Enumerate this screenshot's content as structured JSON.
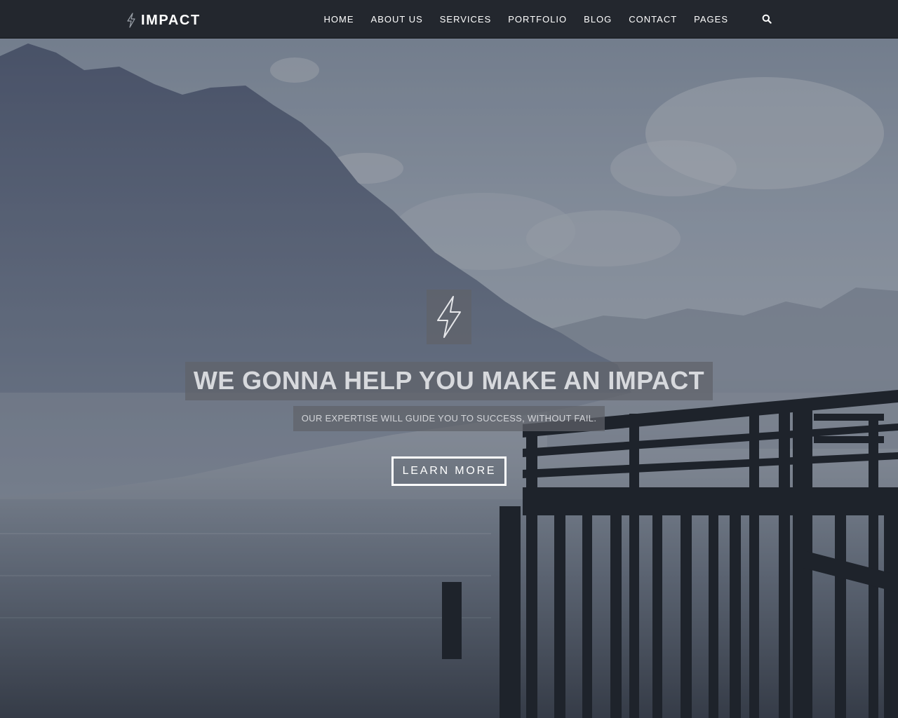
{
  "brand": {
    "name": "IMPACT",
    "icon": "lightning-bolt-icon"
  },
  "nav": {
    "items": [
      {
        "label": "HOME"
      },
      {
        "label": "ABOUT US"
      },
      {
        "label": "SERVICES"
      },
      {
        "label": "PORTFOLIO"
      },
      {
        "label": "BLOG"
      },
      {
        "label": "CONTACT"
      },
      {
        "label": "PAGES"
      }
    ],
    "search_icon": "search-icon"
  },
  "hero": {
    "icon": "lightning-bolt-icon",
    "title": "WE GONNA HELP YOU MAKE AN IMPACT",
    "subtitle": "OUR EXPERTISE WILL GUIDE YOU TO SUCCESS, WITHOUT FAIL.",
    "button_label": "LEARN MORE",
    "background": "lake-mountain-pier-photo"
  },
  "colors": {
    "navbar": "#23272e",
    "text": "#ffffff",
    "caption_box": "#5f626a"
  }
}
